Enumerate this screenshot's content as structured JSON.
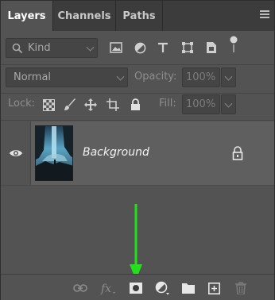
{
  "tabs": [
    {
      "label": "Layers",
      "active": true
    },
    {
      "label": "Channels",
      "active": false
    },
    {
      "label": "Paths",
      "active": false
    }
  ],
  "filter": {
    "kind_label": "Kind",
    "icons": [
      "image-filter-icon",
      "adjustment-filter-icon",
      "type-filter-icon",
      "shape-filter-icon",
      "smart-object-filter-icon",
      "filter-toggle-icon"
    ]
  },
  "blend": {
    "mode": "Normal",
    "opacity_label": "Opacity:",
    "opacity_value": "100%"
  },
  "lock": {
    "label": "Lock:",
    "fill_label": "Fill:",
    "fill_value": "100%",
    "icons": [
      "lock-transparent-pixels-icon",
      "lock-image-pixels-icon",
      "lock-position-icon",
      "lock-artboard-icon",
      "lock-all-icon"
    ]
  },
  "layers": [
    {
      "name": "Background",
      "visible": true,
      "locked": true
    }
  ],
  "bottom_icons": [
    "link-layers-icon",
    "fx-icon",
    "add-mask-icon",
    "adjustment-layer-icon",
    "new-group-icon",
    "new-layer-icon",
    "delete-layer-icon"
  ],
  "colors": {
    "panel_bg": "#535353",
    "tabbar_bg": "#3c3c3c",
    "selected_row": "#5f5f5f",
    "annotation_arrow": "#22e01a"
  }
}
